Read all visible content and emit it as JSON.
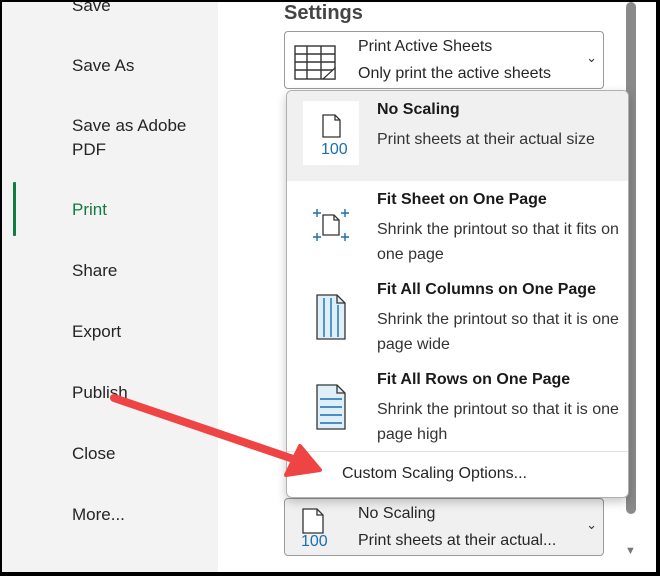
{
  "nav": {
    "items": [
      {
        "label": "Save",
        "active": false
      },
      {
        "label": "Save As",
        "active": false
      },
      {
        "label": "Save as Adobe PDF",
        "active": false
      },
      {
        "label": "Print",
        "active": true
      },
      {
        "label": "Share",
        "active": false
      },
      {
        "label": "Export",
        "active": false
      },
      {
        "label": "Publish",
        "active": false
      },
      {
        "label": "Close",
        "active": false
      },
      {
        "label": "More...",
        "active": false
      }
    ],
    "save_as_adobe_line1": "Save as Adobe",
    "save_as_adobe_line2": "PDF"
  },
  "settings": {
    "title": "Settings",
    "print_what": {
      "title": "Print Active Sheets",
      "desc": "Only print the active sheets",
      "icon": "sheet-grid-icon"
    },
    "scaling": {
      "title": "No Scaling",
      "desc": "Print sheets at their actual...",
      "icon_number": "100",
      "icon": "page-100-icon"
    }
  },
  "scaling_menu": {
    "options": [
      {
        "title": "No Scaling",
        "desc": "Print sheets at their actual size",
        "icon": "page-100-icon",
        "icon_number": "100",
        "selected": true
      },
      {
        "title": "Fit Sheet on One Page",
        "desc": "Shrink the printout so that it fits on one page",
        "icon": "fit-sheet-icon",
        "selected": false
      },
      {
        "title": "Fit All Columns on One Page",
        "desc": "Shrink the printout so that it is one page wide",
        "icon": "fit-columns-icon",
        "selected": false
      },
      {
        "title": "Fit All Rows on One Page",
        "desc": "Shrink the printout so that it is one page high",
        "icon": "fit-rows-icon",
        "selected": false
      }
    ],
    "custom": "Custom Scaling Options..."
  },
  "colors": {
    "accent": "#107c41",
    "icon_blue": "#1a6fb0",
    "arrow_red": "#ef4444"
  }
}
